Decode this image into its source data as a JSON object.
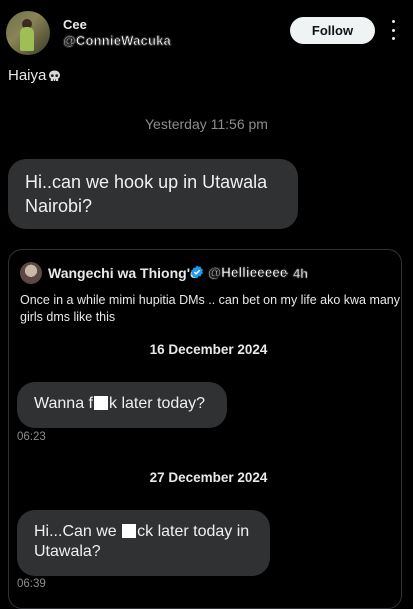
{
  "author": {
    "name": "Cee",
    "handle": "@ConnieWacuka",
    "follow_label": "Follow"
  },
  "post": {
    "text": "Haiya",
    "emoji_icon": "skull-icon"
  },
  "dm": {
    "timestamp": "Yesterday 11:56 pm",
    "message": "Hi..can we hook up in Utawala Nairobi?"
  },
  "quote": {
    "name": "Wangechi wa Thiong'o",
    "handle": "@Hellieeeee",
    "age": "· 4h",
    "body": "Once in a while mimi hupitia DMs .. can bet on my life ako kwa many girls dms like this",
    "date1": "16 December 2024",
    "msg1_before": "Wanna f",
    "msg1_after": "k later today?",
    "time1": "06:23",
    "date2": "27 December 2024",
    "msg2_before": "Hi...Can we ",
    "msg2_after": "ck later today in Utawala?",
    "time2": "06:39"
  },
  "colors": {
    "background": "#000000",
    "bubble": "#2f3133",
    "muted": "#8b8d90",
    "verified": "#1d9bf0"
  }
}
